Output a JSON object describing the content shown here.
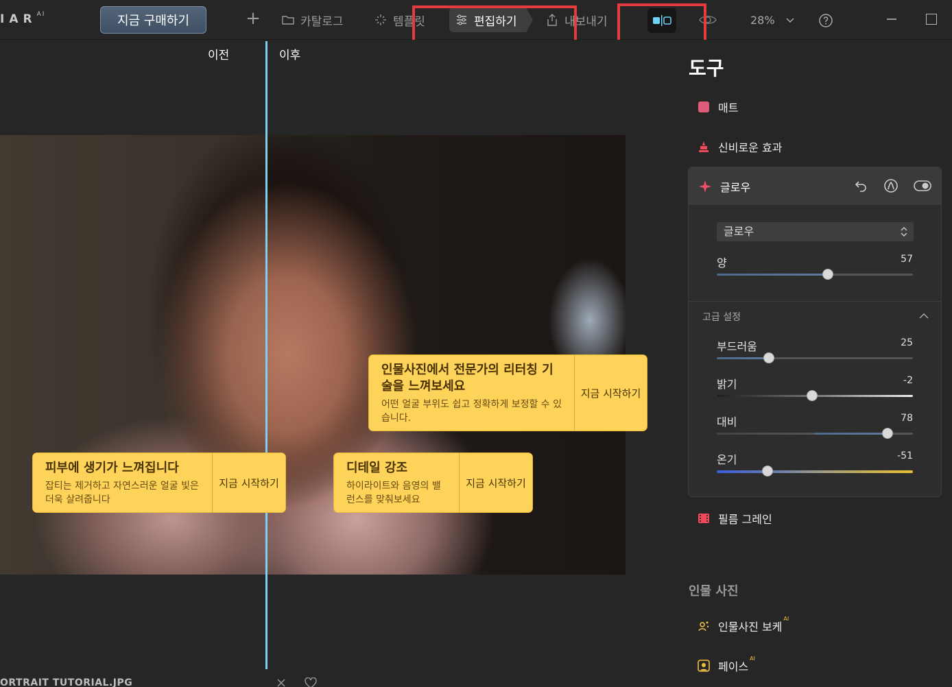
{
  "topbar": {
    "logo": "IAR",
    "logo_sup": "AI",
    "buy_label": "지금 구매하기",
    "nav": {
      "catalog": "카탈로그",
      "templates": "템플릿",
      "edit": "편집하기",
      "export": "내보내기"
    },
    "zoom": "28%"
  },
  "canvas": {
    "label_before": "이전",
    "label_after": "이후",
    "callouts": [
      {
        "title": "인물사진에서 전문가의 리터칭 기술을 느껴보세요",
        "desc": "어떤 얼굴 부위도 쉽고 정확하게 보정할 수 있습니다.",
        "cta": "지금 시작하기"
      },
      {
        "title": "피부에 생기가 느껴집니다",
        "desc": "잡티는 제거하고 자연스러운 얼굴 빛은 더욱 살려줍니다",
        "cta": "지금 시작하기"
      },
      {
        "title": "디테일 강조",
        "desc": "하이라이트와 음영의 밸런스를 맞춰보세요",
        "cta": "지금 시작하기"
      }
    ],
    "filename": "ORTRAIT TUTORIAL.JPG"
  },
  "panel": {
    "title": "도구",
    "tools": {
      "matte": "매트",
      "mystical": "신비로운 효과",
      "glow": "글로우",
      "film_grain": "필름 그레인"
    },
    "glow": {
      "preset": "글로우",
      "amount_label": "양",
      "amount_value": "57",
      "amount": 57,
      "advanced_label": "고급 설정",
      "softness_label": "부드러움",
      "softness_value": "25",
      "softness": 25,
      "brightness_label": "밝기",
      "brightness_value": "-2",
      "brightness": -2,
      "contrast_label": "대비",
      "contrast_value": "78",
      "contrast": 78,
      "warmth_label": "온기",
      "warmth_value": "-51",
      "warmth": -51
    },
    "section_portrait": "인물 사진",
    "portrait_bokeh": "인물사진 보케",
    "face": "페이스",
    "ai_badge": "AI"
  },
  "colors": {
    "accent_split": "#7fd0f4",
    "callout_bg": "#fdd35a",
    "highlight_box": "#e53a3f",
    "matte_swatch": "#e05a7a"
  }
}
